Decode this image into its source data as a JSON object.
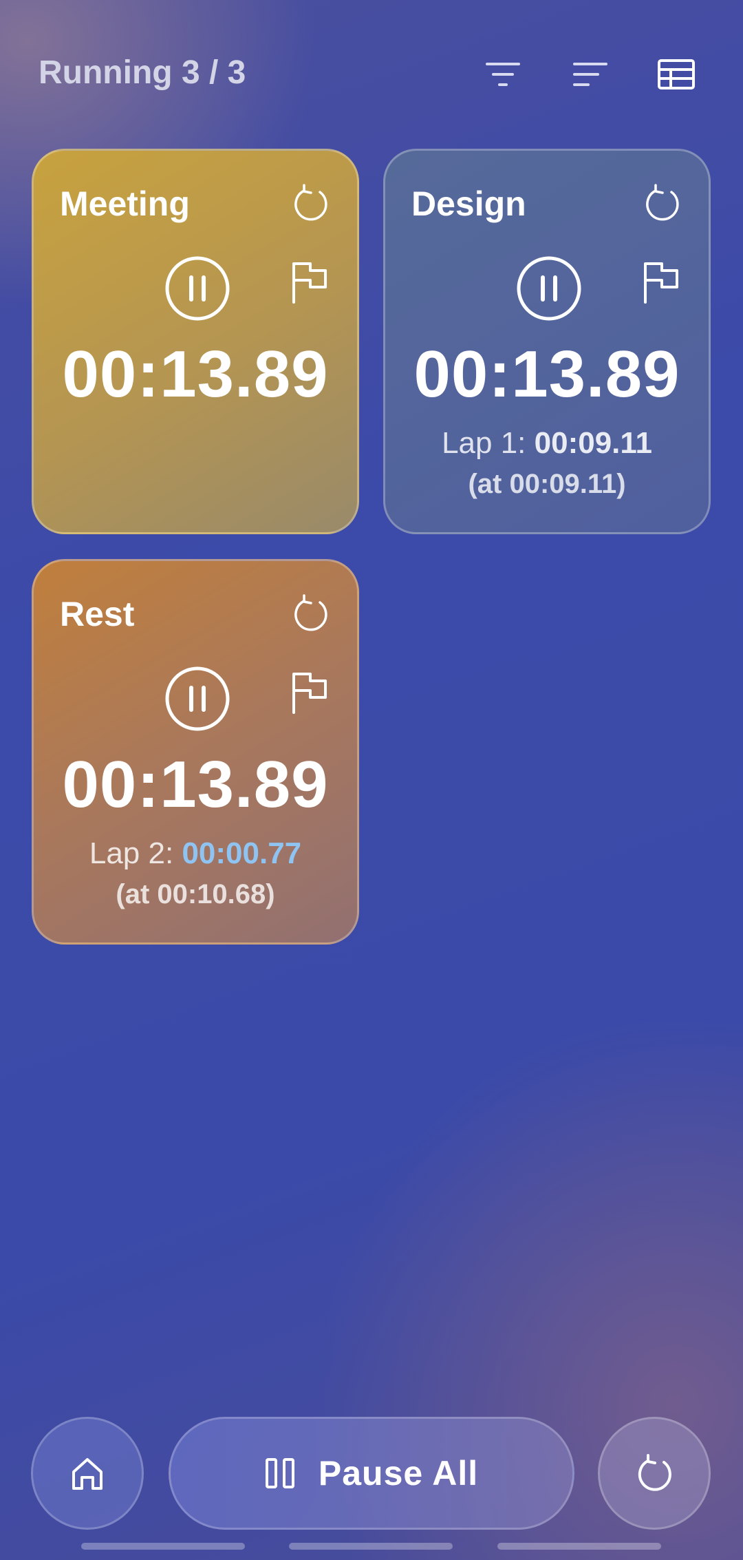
{
  "header": {
    "title": "Running 3 / 3",
    "icons": [
      "filter-icon",
      "sort-icon",
      "table-view-icon"
    ]
  },
  "timers": [
    {
      "name": "Meeting",
      "time": "00:13.89",
      "color": "#c8a23e"
    },
    {
      "name": "Design",
      "time": "00:13.89",
      "color": "#566a9a",
      "lap": {
        "label": "Lap 1:",
        "time": "00:09.11",
        "at": "(at 00:09.11)"
      }
    },
    {
      "name": "Rest",
      "time": "00:13.89",
      "color": "#c07f3c",
      "lap": {
        "label": "Lap 2:",
        "time": "00:00.77",
        "at": "(at 00:10.68)",
        "time_color": "#8fc4f2"
      }
    }
  ],
  "bottom_bar": {
    "pause_all_label": "Pause All",
    "icons": [
      "home-icon",
      "pause-icon",
      "reset-icon"
    ]
  }
}
